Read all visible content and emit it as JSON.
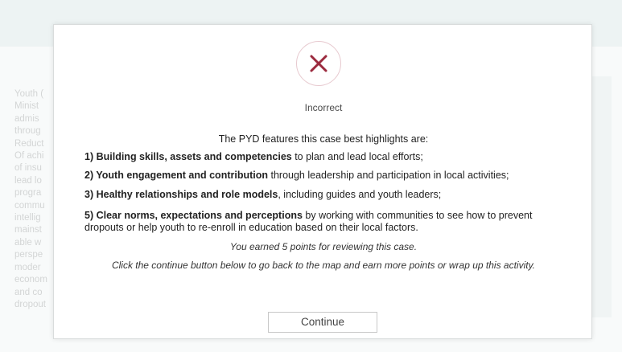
{
  "background": {
    "text_lines": [
      "Youth (",
      "Minist",
      "admis",
      "throug",
      "Reduct",
      "Of achi",
      "of insu",
      "lead lo",
      "progra",
      "commu",
      "intellig",
      "mainst",
      "able w",
      "perspe",
      "moder",
      "econom",
      "and co",
      "dropout"
    ]
  },
  "modal": {
    "icon": "close-x-icon",
    "icon_color": "#9b2a3e",
    "status": "Incorrect",
    "intro": "The PYD features this case best highlights are:",
    "items": [
      {
        "bold": "1) Building skills, assets and competencies",
        "rest": " to plan and lead local efforts;"
      },
      {
        "bold": "2) Youth engagement and contribution",
        "rest": " through leadership and participation in local activities;"
      },
      {
        "bold": "3) Healthy relationships and role models",
        "rest": ", including guides and youth leaders;"
      },
      {
        "bold": "5) Clear norms, expectations and perceptions",
        "rest": " by working with communities to see how to prevent dropouts or help youth to re-enroll in education based on their local factors."
      }
    ],
    "earned": "You earned 5 points for reviewing this case.",
    "instructions": "Click the continue button below to go back to the map and earn more points or wrap up this activity.",
    "continue_label": "Continue"
  }
}
